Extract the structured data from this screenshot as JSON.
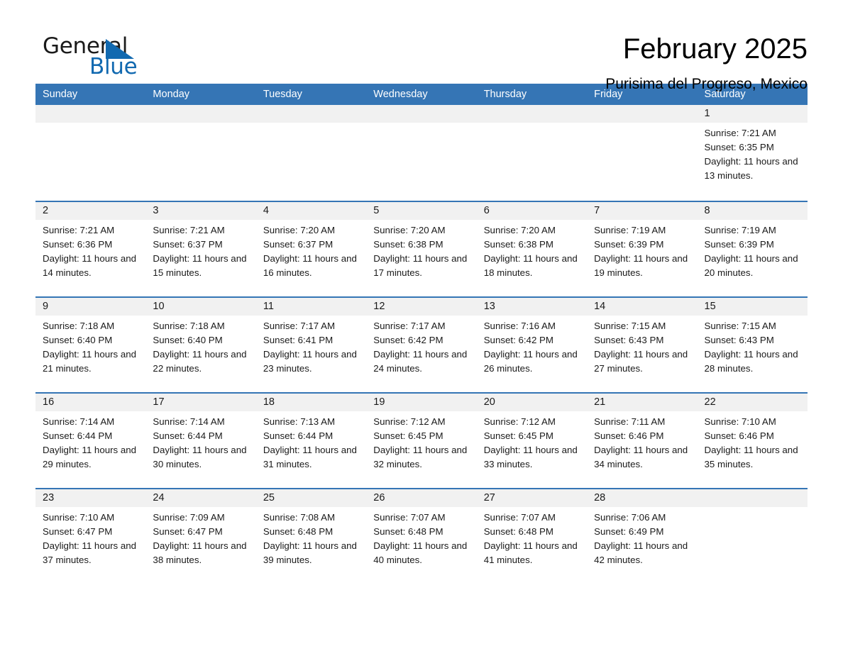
{
  "logo": {
    "word_top": "General",
    "word_bottom": "Blue",
    "triangle_icon": "triangle-icon",
    "brand_color": "#1169b0"
  },
  "header": {
    "title": "February 2025",
    "location": "Purisima del Progreso, Mexico"
  },
  "calendar": {
    "header_color": "#3575b5",
    "day_band_color": "#f1f1f1",
    "weekdays": [
      "Sunday",
      "Monday",
      "Tuesday",
      "Wednesday",
      "Thursday",
      "Friday",
      "Saturday"
    ],
    "weeks": [
      [
        {
          "date": ""
        },
        {
          "date": ""
        },
        {
          "date": ""
        },
        {
          "date": ""
        },
        {
          "date": ""
        },
        {
          "date": ""
        },
        {
          "date": "1",
          "sunrise": "Sunrise: 7:21 AM",
          "sunset": "Sunset: 6:35 PM",
          "daylight": "Daylight: 11 hours and 13 minutes."
        }
      ],
      [
        {
          "date": "2",
          "sunrise": "Sunrise: 7:21 AM",
          "sunset": "Sunset: 6:36 PM",
          "daylight": "Daylight: 11 hours and 14 minutes."
        },
        {
          "date": "3",
          "sunrise": "Sunrise: 7:21 AM",
          "sunset": "Sunset: 6:37 PM",
          "daylight": "Daylight: 11 hours and 15 minutes."
        },
        {
          "date": "4",
          "sunrise": "Sunrise: 7:20 AM",
          "sunset": "Sunset: 6:37 PM",
          "daylight": "Daylight: 11 hours and 16 minutes."
        },
        {
          "date": "5",
          "sunrise": "Sunrise: 7:20 AM",
          "sunset": "Sunset: 6:38 PM",
          "daylight": "Daylight: 11 hours and 17 minutes."
        },
        {
          "date": "6",
          "sunrise": "Sunrise: 7:20 AM",
          "sunset": "Sunset: 6:38 PM",
          "daylight": "Daylight: 11 hours and 18 minutes."
        },
        {
          "date": "7",
          "sunrise": "Sunrise: 7:19 AM",
          "sunset": "Sunset: 6:39 PM",
          "daylight": "Daylight: 11 hours and 19 minutes."
        },
        {
          "date": "8",
          "sunrise": "Sunrise: 7:19 AM",
          "sunset": "Sunset: 6:39 PM",
          "daylight": "Daylight: 11 hours and 20 minutes."
        }
      ],
      [
        {
          "date": "9",
          "sunrise": "Sunrise: 7:18 AM",
          "sunset": "Sunset: 6:40 PM",
          "daylight": "Daylight: 11 hours and 21 minutes."
        },
        {
          "date": "10",
          "sunrise": "Sunrise: 7:18 AM",
          "sunset": "Sunset: 6:40 PM",
          "daylight": "Daylight: 11 hours and 22 minutes."
        },
        {
          "date": "11",
          "sunrise": "Sunrise: 7:17 AM",
          "sunset": "Sunset: 6:41 PM",
          "daylight": "Daylight: 11 hours and 23 minutes."
        },
        {
          "date": "12",
          "sunrise": "Sunrise: 7:17 AM",
          "sunset": "Sunset: 6:42 PM",
          "daylight": "Daylight: 11 hours and 24 minutes."
        },
        {
          "date": "13",
          "sunrise": "Sunrise: 7:16 AM",
          "sunset": "Sunset: 6:42 PM",
          "daylight": "Daylight: 11 hours and 26 minutes."
        },
        {
          "date": "14",
          "sunrise": "Sunrise: 7:15 AM",
          "sunset": "Sunset: 6:43 PM",
          "daylight": "Daylight: 11 hours and 27 minutes."
        },
        {
          "date": "15",
          "sunrise": "Sunrise: 7:15 AM",
          "sunset": "Sunset: 6:43 PM",
          "daylight": "Daylight: 11 hours and 28 minutes."
        }
      ],
      [
        {
          "date": "16",
          "sunrise": "Sunrise: 7:14 AM",
          "sunset": "Sunset: 6:44 PM",
          "daylight": "Daylight: 11 hours and 29 minutes."
        },
        {
          "date": "17",
          "sunrise": "Sunrise: 7:14 AM",
          "sunset": "Sunset: 6:44 PM",
          "daylight": "Daylight: 11 hours and 30 minutes."
        },
        {
          "date": "18",
          "sunrise": "Sunrise: 7:13 AM",
          "sunset": "Sunset: 6:44 PM",
          "daylight": "Daylight: 11 hours and 31 minutes."
        },
        {
          "date": "19",
          "sunrise": "Sunrise: 7:12 AM",
          "sunset": "Sunset: 6:45 PM",
          "daylight": "Daylight: 11 hours and 32 minutes."
        },
        {
          "date": "20",
          "sunrise": "Sunrise: 7:12 AM",
          "sunset": "Sunset: 6:45 PM",
          "daylight": "Daylight: 11 hours and 33 minutes."
        },
        {
          "date": "21",
          "sunrise": "Sunrise: 7:11 AM",
          "sunset": "Sunset: 6:46 PM",
          "daylight": "Daylight: 11 hours and 34 minutes."
        },
        {
          "date": "22",
          "sunrise": "Sunrise: 7:10 AM",
          "sunset": "Sunset: 6:46 PM",
          "daylight": "Daylight: 11 hours and 35 minutes."
        }
      ],
      [
        {
          "date": "23",
          "sunrise": "Sunrise: 7:10 AM",
          "sunset": "Sunset: 6:47 PM",
          "daylight": "Daylight: 11 hours and 37 minutes."
        },
        {
          "date": "24",
          "sunrise": "Sunrise: 7:09 AM",
          "sunset": "Sunset: 6:47 PM",
          "daylight": "Daylight: 11 hours and 38 minutes."
        },
        {
          "date": "25",
          "sunrise": "Sunrise: 7:08 AM",
          "sunset": "Sunset: 6:48 PM",
          "daylight": "Daylight: 11 hours and 39 minutes."
        },
        {
          "date": "26",
          "sunrise": "Sunrise: 7:07 AM",
          "sunset": "Sunset: 6:48 PM",
          "daylight": "Daylight: 11 hours and 40 minutes."
        },
        {
          "date": "27",
          "sunrise": "Sunrise: 7:07 AM",
          "sunset": "Sunset: 6:48 PM",
          "daylight": "Daylight: 11 hours and 41 minutes."
        },
        {
          "date": "28",
          "sunrise": "Sunrise: 7:06 AM",
          "sunset": "Sunset: 6:49 PM",
          "daylight": "Daylight: 11 hours and 42 minutes."
        },
        {
          "date": ""
        }
      ]
    ]
  }
}
